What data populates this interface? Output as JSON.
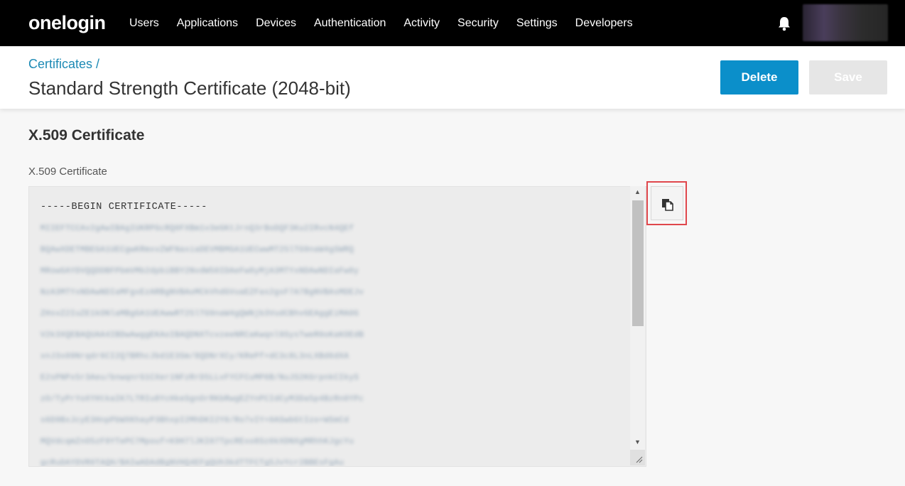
{
  "nav": {
    "logo": "onelogin",
    "links": [
      "Users",
      "Applications",
      "Devices",
      "Authentication",
      "Activity",
      "Security",
      "Settings",
      "Developers"
    ]
  },
  "header": {
    "breadcrumb": "Certificates",
    "breadcrumb_sep": " /",
    "title": "Standard Strength Certificate (2048-bit)",
    "delete_label": "Delete",
    "save_label": "Save"
  },
  "section": {
    "title": "X.509 Certificate",
    "field_label": "X.509 Certificate",
    "cert_begin": "-----BEGIN CERTIFICATE-----",
    "cert_lines": [
      "MIIEFTCCAv2gAwIBAgIUKRPGcRQ0FXBm1v3eGKtJrnQ3rBoDQF3Ku2IRvcN4QEf",
      "BQAwXDETMBEGA1UECgwKRmxvZWFNaxiaDEVMBMGA1UECwwMT25lTG9naW4gSWRQ",
      "MRowGAYDVQQDDBFPbmVMb2dpbiBBY2NvdW50IDAeFw0yMjA3MTYxNDAwNDIaFw0y",
      "NzA3MTYxNDAwNDIaMFgxEzARBgNVBAoMCkVhdGVuaEZFas2gsF7A7BgNVBAsMDEJv",
      "ZHsvZ2IuZE1kONlaMBgGA1UEAwwRT25lTG9naW4gQWNjb3VudCBhvGEAggEiMA0G",
      "V2k3XQEBAQUAA4IBDwAwggEKAoIBAQDNXTcvzeeNRCaKwqnl9SysTweR0oKaKOEdB",
      "xnJ3x09Nrqdr6CI2Q7BRhcJbd1E3Sm/8QDNrXCy/KRePf+dC3c8L3nLXBd6dXA",
      "E2sPNPx5r3Aeu/bnwqnrG1CXer1NFzRrD5LLvFYCFCuMP6B/NuJS2KGrpnkCIkyS",
      "zO/TyPrYoXYHtkaIK7LTRIu8YcHkeSgnOrRKbRwgEZYnPCIdCyM3Da5p4BzRn0YPc",
      "s6D9BxJcyE3HnpPbWXKhayP3BhxpI2MhDKI2Y6/Ro7vIY+0ASwbGtIzo+WSmCd",
      "MQVdcqmZnO5zF9YTePC7Mpouf+K9H7lJKI07TpcRExo8Sz6kXDNXgMRhhKJgcYu",
      "gcRuDAYDVR0TAQH/BAIwADAdBgNVHQ4EFgQUh3kdTTFCTg5JvYcr2BBEsFgAu"
    ]
  }
}
